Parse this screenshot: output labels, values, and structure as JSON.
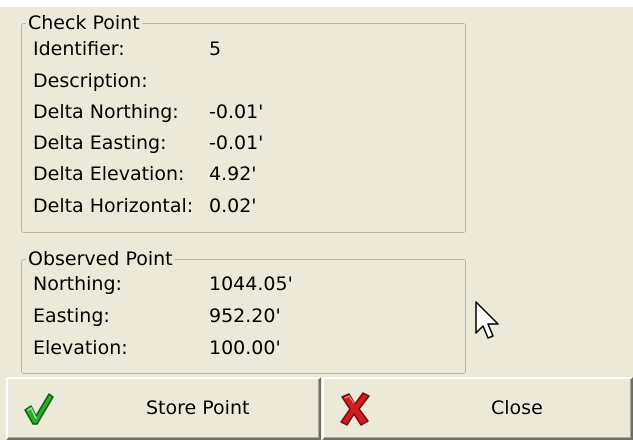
{
  "check_point": {
    "title": "Check Point",
    "rows": [
      {
        "label": "Identifier:",
        "value": "5"
      },
      {
        "label": "Description:",
        "value": ""
      },
      {
        "label": "Delta Northing:",
        "value": "-0.01'"
      },
      {
        "label": "Delta Easting:",
        "value": "-0.01'"
      },
      {
        "label": "Delta Elevation:",
        "value": "4.92'"
      },
      {
        "label": "Delta Horizontal:",
        "value": "0.02'"
      }
    ]
  },
  "observed_point": {
    "title": "Observed Point",
    "rows": [
      {
        "label": "Northing:",
        "value": "1044.05'"
      },
      {
        "label": "Easting:",
        "value": "952.20'"
      },
      {
        "label": "Elevation:",
        "value": "100.00'"
      }
    ]
  },
  "buttons": {
    "store_point": {
      "label": "Store Point",
      "icon": "checkmark-icon",
      "icon_color": "#2ea82e"
    },
    "close": {
      "label": "Close",
      "icon": "red-x-icon",
      "icon_color": "#d01e1e"
    }
  },
  "colors": {
    "panel_background": "#ece9d8",
    "group_border": "#b8b4a4"
  }
}
